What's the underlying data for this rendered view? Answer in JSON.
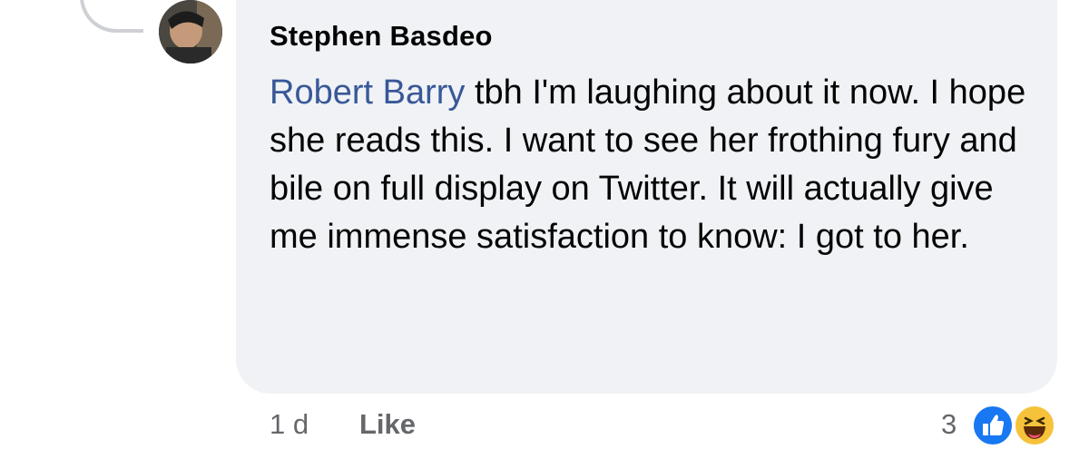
{
  "comment": {
    "author": "Stephen Basdeo",
    "mention": "Robert Barry",
    "text": " tbh I'm laughing about it now. I hope she reads this. I want to see her frothing fury and bile on full display on Twitter. It will actually give me immense satisfaction to know: I got to her."
  },
  "footer": {
    "time": "1 d",
    "like_label": "Like",
    "reaction_count": "3",
    "reactions": [
      "like-icon",
      "haha-icon"
    ]
  },
  "colors": {
    "bubble": "#f0f2f5",
    "mention": "#385898",
    "meta": "#65676b",
    "like_blue": "#1877f2",
    "haha_yellow": "#f7c23b"
  }
}
